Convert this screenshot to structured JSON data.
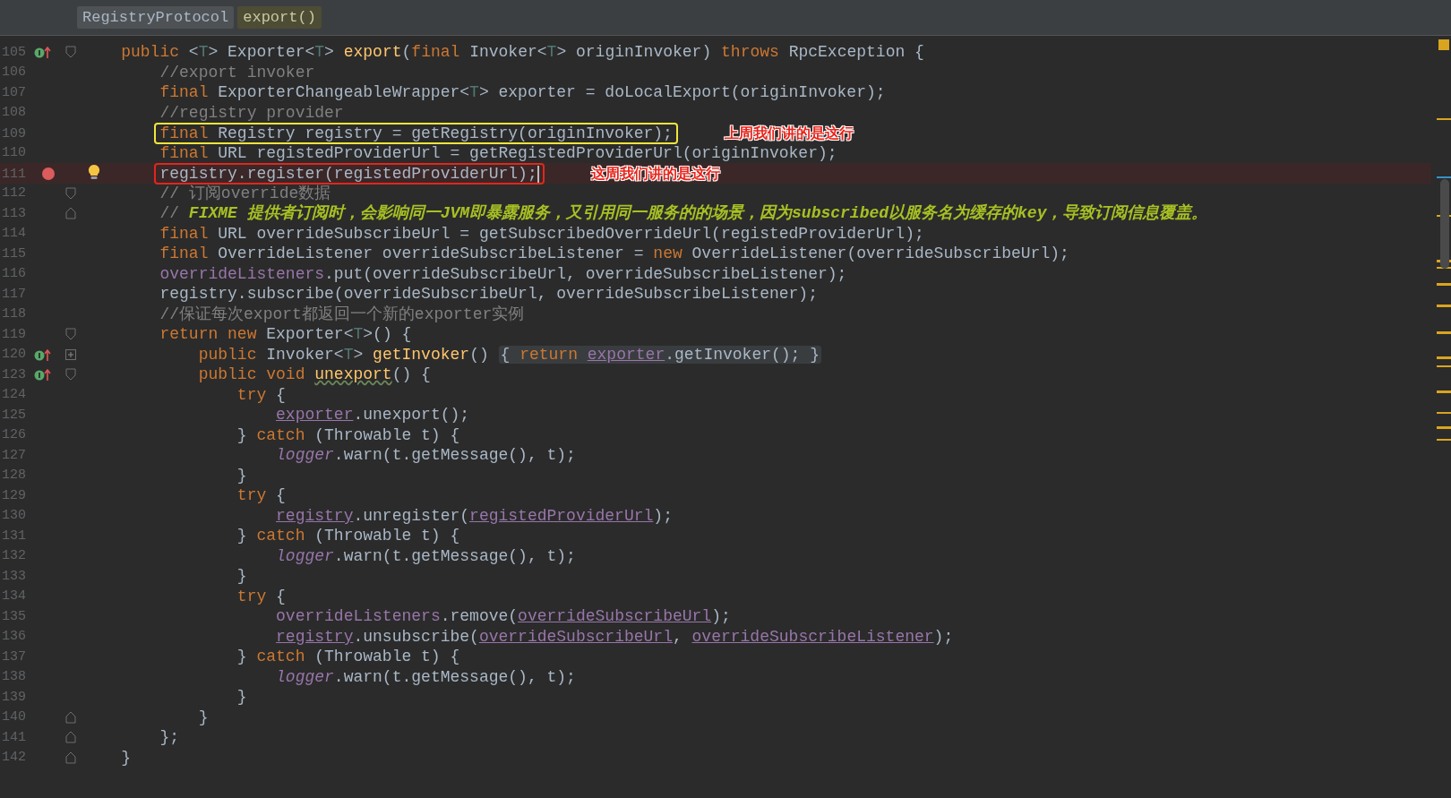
{
  "breadcrumb": [
    {
      "label": "RegistryProtocol",
      "selected": false
    },
    {
      "label": "export()",
      "selected": true
    }
  ],
  "lines": [
    {
      "number": "105",
      "gutter": {
        "kind": "override"
      },
      "fold": {
        "kind": "open"
      },
      "tokens": [
        {
          "kind": "kw",
          "text": "    public "
        },
        {
          "kind": "pl",
          "text": "<"
        },
        {
          "kind": "tp",
          "text": "T"
        },
        {
          "kind": "pl",
          "text": "> Exporter<"
        },
        {
          "kind": "tp",
          "text": "T"
        },
        {
          "kind": "pl",
          "text": "> "
        },
        {
          "kind": "fn",
          "text": "export"
        },
        {
          "kind": "pl",
          "text": "("
        },
        {
          "kind": "kw",
          "text": "final "
        },
        {
          "kind": "pl",
          "text": "Invoker<"
        },
        {
          "kind": "tp",
          "text": "T"
        },
        {
          "kind": "pl",
          "text": "> originInvoker) "
        },
        {
          "kind": "kw",
          "text": "throws "
        },
        {
          "kind": "pl",
          "text": "RpcException {"
        }
      ]
    },
    {
      "number": "106",
      "tokens": [
        {
          "kind": "cm",
          "text": "        //export invoker"
        }
      ]
    },
    {
      "number": "107",
      "tokens": [
        {
          "kind": "kw",
          "text": "        final "
        },
        {
          "kind": "pl",
          "text": "ExporterChangeableWrapper<"
        },
        {
          "kind": "tp",
          "text": "T"
        },
        {
          "kind": "pl",
          "text": "> exporter = doLocalExport(originInvoker);"
        }
      ]
    },
    {
      "number": "108",
      "tokens": [
        {
          "kind": "cm",
          "text": "        //registry provider"
        }
      ]
    },
    {
      "number": "109",
      "box": {
        "color": "#f2e53c"
      },
      "note": "上周我们讲的是这行",
      "tokens": [
        {
          "kind": "kw",
          "text": "        final "
        },
        {
          "kind": "pl",
          "text": "Registry registry = getRegistry(originInvoker);"
        }
      ]
    },
    {
      "number": "110",
      "tokens": [
        {
          "kind": "kw",
          "text": "        final "
        },
        {
          "kind": "pl",
          "text": "URL registedProviderUrl = getRegistedProviderUrl(originInvoker);"
        }
      ]
    },
    {
      "number": "111",
      "gutter": {
        "kind": "breakpoint"
      },
      "bulb": true,
      "caret": true,
      "box": {
        "color": "#e0261e"
      },
      "note": "这周我们讲的是这行",
      "tokens": [
        {
          "kind": "pl",
          "text": "        registry.register(registedProviderUrl);"
        }
      ]
    },
    {
      "number": "112",
      "fold": {
        "kind": "open"
      },
      "tokens": [
        {
          "kind": "cm",
          "text": "        // 订阅override数据"
        }
      ]
    },
    {
      "number": "113",
      "fold": {
        "kind": "close"
      },
      "tokens": [
        {
          "kind": "cm",
          "text": "        // "
        },
        {
          "kind": "todo",
          "text": "FIXME 提供者订阅时，会影响同一JVM即暴露服务，又引用同一服务的的场景，因为subscribed以服务名为缓存的key，导致订阅信息覆盖。"
        }
      ]
    },
    {
      "number": "114",
      "tokens": [
        {
          "kind": "kw",
          "text": "        final "
        },
        {
          "kind": "pl",
          "text": "URL overrideSubscribeUrl = getSubscribedOverrideUrl(registedProviderUrl);"
        }
      ]
    },
    {
      "number": "115",
      "tokens": [
        {
          "kind": "kw",
          "text": "        final "
        },
        {
          "kind": "pl",
          "text": "OverrideListener overrideSubscribeListener = "
        },
        {
          "kind": "kw",
          "text": "new "
        },
        {
          "kind": "pl",
          "text": "OverrideListener(overrideSubscribeUrl);"
        }
      ]
    },
    {
      "number": "116",
      "tokens": [
        {
          "kind": "fld",
          "text": "        overrideListeners"
        },
        {
          "kind": "pl",
          "text": ".put(overrideSubscribeUrl, overrideSubscribeListener);"
        }
      ]
    },
    {
      "number": "117",
      "tokens": [
        {
          "kind": "pl",
          "text": "        registry.subscribe(overrideSubscribeUrl, overrideSubscribeListener);"
        }
      ]
    },
    {
      "number": "118",
      "tokens": [
        {
          "kind": "cm",
          "text": "        //保证每次export都返回一个新的exporter实例"
        }
      ]
    },
    {
      "number": "119",
      "fold": {
        "kind": "open"
      },
      "tokens": [
        {
          "kind": "kw",
          "text": "        return new "
        },
        {
          "kind": "pl",
          "text": "Exporter<"
        },
        {
          "kind": "tp",
          "text": "T"
        },
        {
          "kind": "pl",
          "text": ">() {"
        }
      ]
    },
    {
      "number": "120",
      "gutter": {
        "kind": "override"
      },
      "fold": {
        "kind": "plus"
      },
      "tokens": [
        {
          "kind": "kw",
          "text": "            public "
        },
        {
          "kind": "pl",
          "text": "Invoker<"
        },
        {
          "kind": "tp",
          "text": "T"
        },
        {
          "kind": "pl",
          "text": "> "
        },
        {
          "kind": "fn",
          "text": "getInvoker"
        },
        {
          "kind": "pl",
          "text": "() "
        },
        {
          "kind": "folded",
          "tokens": [
            {
              "kind": "pl",
              "text": "{ "
            },
            {
              "kind": "kw",
              "text": "return "
            },
            {
              "kind": "fldu",
              "text": "exporter"
            },
            {
              "kind": "pl",
              "text": ".getInvoker(); }"
            }
          ]
        }
      ]
    },
    {
      "number": "123",
      "gutter": {
        "kind": "override"
      },
      "fold": {
        "kind": "open"
      },
      "tokens": [
        {
          "kind": "kw",
          "text": "            public void "
        },
        {
          "kind": "unused",
          "text": "unexport"
        },
        {
          "kind": "pl",
          "text": "() {"
        }
      ]
    },
    {
      "number": "124",
      "tokens": [
        {
          "kind": "kw",
          "text": "                try "
        },
        {
          "kind": "pl",
          "text": "{"
        }
      ]
    },
    {
      "number": "125",
      "tokens": [
        {
          "kind": "fldu",
          "text": "                    exporter"
        },
        {
          "kind": "pl",
          "text": ".unexport();"
        }
      ]
    },
    {
      "number": "126",
      "tokens": [
        {
          "kind": "pl",
          "text": "                } "
        },
        {
          "kind": "kw",
          "text": "catch "
        },
        {
          "kind": "pl",
          "text": "(Throwable t) {"
        }
      ]
    },
    {
      "number": "127",
      "tokens": [
        {
          "kind": "st",
          "text": "                    logger"
        },
        {
          "kind": "pl",
          "text": ".warn(t.getMessage(), t);"
        }
      ]
    },
    {
      "number": "128",
      "tokens": [
        {
          "kind": "pl",
          "text": "                }"
        }
      ]
    },
    {
      "number": "129",
      "tokens": [
        {
          "kind": "kw",
          "text": "                try "
        },
        {
          "kind": "pl",
          "text": "{"
        }
      ]
    },
    {
      "number": "130",
      "tokens": [
        {
          "kind": "fldu",
          "text": "                    registry"
        },
        {
          "kind": "pl",
          "text": ".unregister("
        },
        {
          "kind": "fldu",
          "text": "registedProviderUrl"
        },
        {
          "kind": "pl",
          "text": ");"
        }
      ]
    },
    {
      "number": "131",
      "tokens": [
        {
          "kind": "pl",
          "text": "                } "
        },
        {
          "kind": "kw",
          "text": "catch "
        },
        {
          "kind": "pl",
          "text": "(Throwable t) {"
        }
      ]
    },
    {
      "number": "132",
      "tokens": [
        {
          "kind": "st",
          "text": "                    logger"
        },
        {
          "kind": "pl",
          "text": ".warn(t.getMessage(), t);"
        }
      ]
    },
    {
      "number": "133",
      "tokens": [
        {
          "kind": "pl",
          "text": "                }"
        }
      ]
    },
    {
      "number": "134",
      "tokens": [
        {
          "kind": "kw",
          "text": "                try "
        },
        {
          "kind": "pl",
          "text": "{"
        }
      ]
    },
    {
      "number": "135",
      "tokens": [
        {
          "kind": "fld",
          "text": "                    overrideListeners"
        },
        {
          "kind": "pl",
          "text": ".remove("
        },
        {
          "kind": "fldu",
          "text": "overrideSubscribeUrl"
        },
        {
          "kind": "pl",
          "text": ");"
        }
      ]
    },
    {
      "number": "136",
      "tokens": [
        {
          "kind": "fldu",
          "text": "                    registry"
        },
        {
          "kind": "pl",
          "text": ".unsubscribe("
        },
        {
          "kind": "fldu",
          "text": "overrideSubscribeUrl"
        },
        {
          "kind": "pl",
          "text": ", "
        },
        {
          "kind": "fldu",
          "text": "overrideSubscribeListener"
        },
        {
          "kind": "pl",
          "text": ");"
        }
      ]
    },
    {
      "number": "137",
      "tokens": [
        {
          "kind": "pl",
          "text": "                } "
        },
        {
          "kind": "kw",
          "text": "catch "
        },
        {
          "kind": "pl",
          "text": "(Throwable t) {"
        }
      ]
    },
    {
      "number": "138",
      "tokens": [
        {
          "kind": "st",
          "text": "                    logger"
        },
        {
          "kind": "pl",
          "text": ".warn(t.getMessage(), t);"
        }
      ]
    },
    {
      "number": "139",
      "tokens": [
        {
          "kind": "pl",
          "text": "                }"
        }
      ]
    },
    {
      "number": "140",
      "fold": {
        "kind": "close"
      },
      "tokens": [
        {
          "kind": "pl",
          "text": "            }"
        }
      ]
    },
    {
      "number": "141",
      "fold": {
        "kind": "close"
      },
      "tokens": [
        {
          "kind": "pl",
          "text": "        };"
        }
      ]
    },
    {
      "number": "142",
      "fold": {
        "kind": "close"
      },
      "tokens": [
        {
          "kind": "pl",
          "text": "    }"
        }
      ]
    }
  ]
}
